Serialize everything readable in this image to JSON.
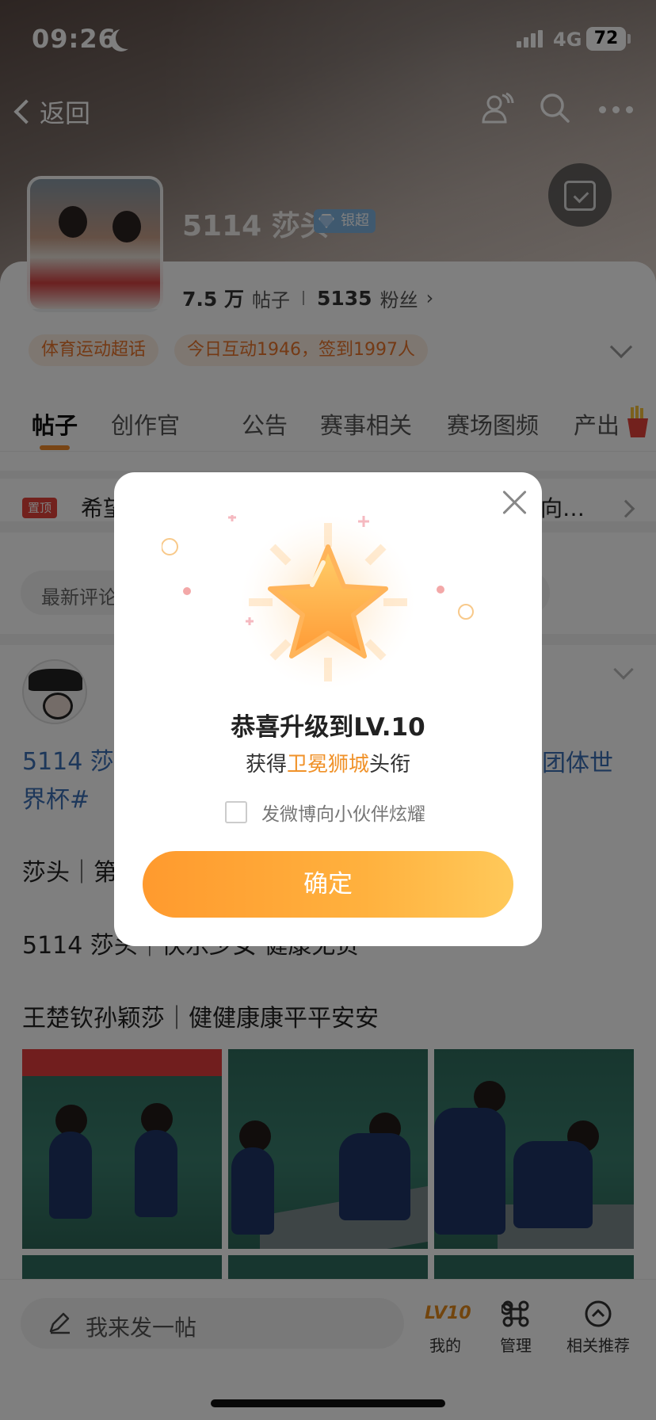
{
  "status_bar": {
    "time": "09:26",
    "network": "4G",
    "battery": "72"
  },
  "nav": {
    "back_label": "返回"
  },
  "profile": {
    "name": "5114 莎头",
    "badge": "银超",
    "posts_count": "7.5 万",
    "posts_label": "帖子",
    "fans_count": "5135",
    "fans_label": "粉丝",
    "tags": [
      "体育运动超话",
      "今日互动1946，签到1997人"
    ]
  },
  "tabs": [
    "帖子",
    "创作官",
    "公告",
    "赛事相关",
    "赛场图频",
    "产出"
  ],
  "pinned": {
    "tag": "置顶",
    "text": "希望",
    "text_tail": "向…"
  },
  "sort": {
    "label": "最新评论"
  },
  "post": {
    "topic_left": "5114 莎",
    "topic_left_line2": "界杯#",
    "topic_right": "团体世",
    "line1": "莎头｜第",
    "line2": "5114 莎头｜快乐少女 健康无负",
    "line3": "王楚钦孙颖莎｜健健康康平平安安"
  },
  "bottom_bar": {
    "compose_placeholder": "我来发一帖",
    "items": [
      "我的",
      "管理",
      "相关推荐"
    ],
    "level_badge": "LV10"
  },
  "modal": {
    "title": "恭喜升级到LV.10",
    "subtitle_prefix": "获得",
    "subtitle_highlight": "卫冕狮城",
    "subtitle_suffix": "头衔",
    "share_label": "发微博向小伙伴炫耀",
    "share_checked": false,
    "confirm_label": "确定"
  },
  "colors": {
    "accent": "#f0922a",
    "link": "#3b6fb5",
    "pinned_red": "#e4433b"
  }
}
